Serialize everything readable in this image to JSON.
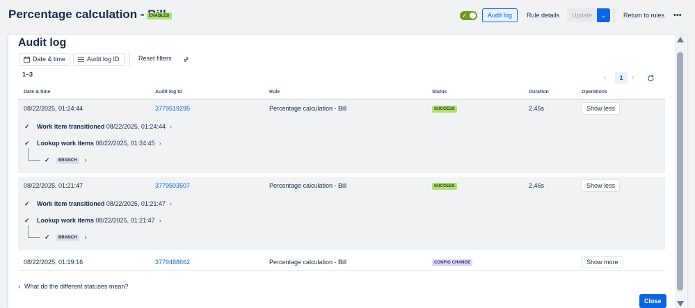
{
  "header": {
    "title": "Percentage calculation - Bill",
    "status_badge": "ENABLED",
    "toggle_on": true,
    "audit_log_label": "Audit log",
    "rule_details_label": "Rule details",
    "update_label": "Update",
    "return_label": "Return to rules",
    "more_label": "•••"
  },
  "modal": {
    "title": "Audit log",
    "filters": {
      "date_time": "Date & time",
      "audit_log_id": "Audit log ID",
      "reset": "Reset filters"
    },
    "count": "1–3",
    "pager": {
      "page": "1"
    },
    "columns": [
      "Date & time",
      "Audit log ID",
      "Rule",
      "Status",
      "Duration",
      "Operations"
    ],
    "rows": [
      {
        "datetime": "08/22/2025, 01:24:44",
        "id": "3779519295",
        "rule": "Percentage calculation - Bill",
        "status": "SUCCESS",
        "duration": "2.45s",
        "action": "Show less",
        "details": [
          {
            "label": "Work item transitioned",
            "time": "08/22/2025, 01:24:44"
          },
          {
            "label": "Lookup work items",
            "time": "08/22/2025, 01:24:45"
          }
        ],
        "branch": "BRANCH"
      },
      {
        "datetime": "08/22/2025, 01:21:47",
        "id": "3779503507",
        "rule": "Percentage calculation - Bill",
        "status": "SUCCESS",
        "duration": "2.46s",
        "action": "Show less",
        "details": [
          {
            "label": "Work item transitioned",
            "time": "08/22/2025, 01:21:47"
          },
          {
            "label": "Lookup work items",
            "time": "08/22/2025, 01:21:47"
          }
        ],
        "branch": "BRANCH"
      },
      {
        "datetime": "08/22/2025, 01:19:16",
        "id": "3779488662",
        "rule": "Percentage calculation - Bill",
        "status": "CONFIG CHANGE",
        "duration": "",
        "action": "Show more"
      }
    ],
    "faq": "What do the different statuses mean?",
    "close_label": "Close"
  },
  "colors": {
    "primary": "#0c66e4",
    "success_bg": "#b3df72",
    "config_bg": "#dfd8fd",
    "expanded_bg": "#f1f2f4"
  },
  "icons": [
    "calendar-icon",
    "list-icon",
    "link-icon",
    "refresh-icon",
    "check-icon",
    "chevron-right-icon",
    "chevron-down-icon",
    "more-icon"
  ]
}
